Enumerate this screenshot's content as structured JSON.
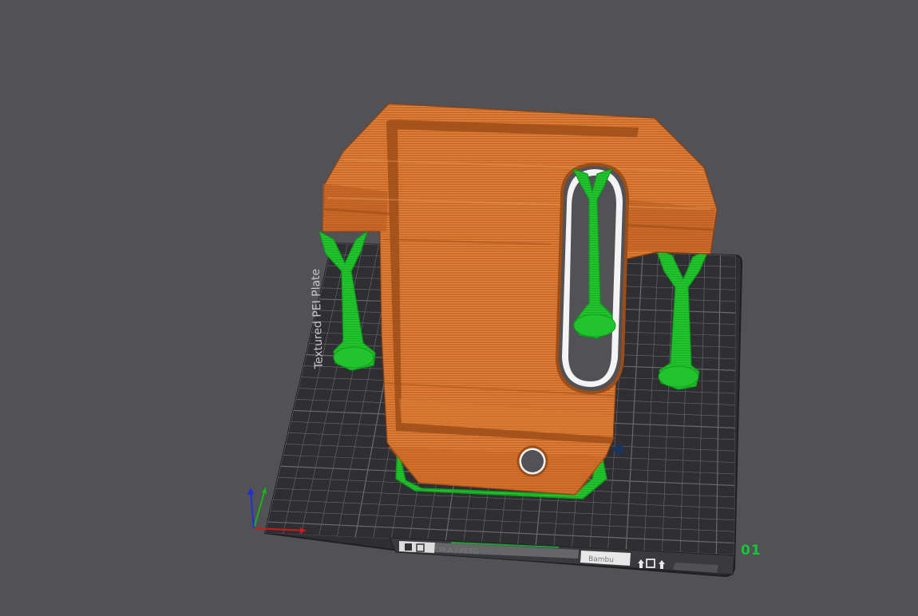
{
  "viewport": {
    "plate_label": "Textured PEI Plate",
    "plate_index": "01",
    "plate_info": "PLA / PETG",
    "plate_info_right": "Bambu",
    "colors": {
      "background": "#515156",
      "bed": "#2f2f33",
      "grid_line": "#6a6a6e",
      "model": "#cd6a27",
      "model_light": "#e08a45",
      "model_dark": "#9c4d18",
      "support": "#22c42e",
      "support_dark": "#139a1e",
      "plate_index_color": "#18c43a",
      "axis_x": "#d01818",
      "axis_y": "#18b418",
      "axis_z": "#2030d8"
    },
    "icons": {
      "plate_toolbar_left": [
        "grid-icon",
        "arrange-icon"
      ],
      "plate_toolbar_right": [
        "upload-icon",
        "square-icon",
        "upload-icon"
      ]
    }
  }
}
